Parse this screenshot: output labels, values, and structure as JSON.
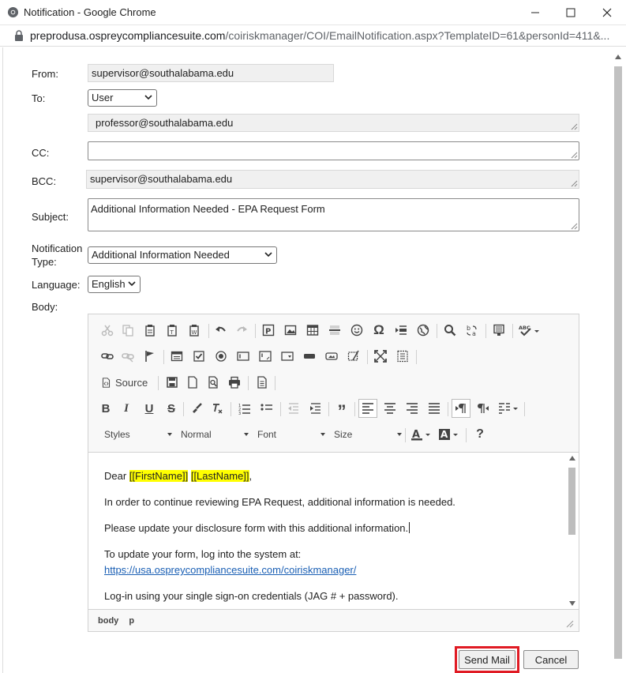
{
  "window": {
    "title": "Notification - Google Chrome",
    "url_host": "preprodusa.ospreycompliancesuite.com",
    "url_path": "/coiriskmanager/COI/EmailNotification.aspx?TemplateID=61&personId=411&..."
  },
  "form": {
    "from_label": "From:",
    "from_value": "supervisor@southalabama.edu",
    "to_label": "To:",
    "to_type": "User",
    "to_value": "professor@southalabama.edu",
    "cc_label": "CC:",
    "cc_value": "",
    "bcc_label": "BCC:",
    "bcc_value": "supervisor@southalabama.edu",
    "subject_label": "Subject:",
    "subject_value": "Additional Information Needed - EPA Request Form",
    "notif_label_1": "Notification",
    "notif_label_2": "Type:",
    "notif_value": "Additional Information Needed",
    "language_label": "Language:",
    "language_value": "English",
    "body_label": "Body:"
  },
  "toolbar": {
    "source_label": "Source",
    "styles_label": "Styles",
    "format_label": "Normal",
    "font_label": "Font",
    "size_label": "Size",
    "bold": "B",
    "italic": "I",
    "underline": "U",
    "strike": "S",
    "help": "?"
  },
  "body_content": {
    "greeting_prefix": "Dear ",
    "token_first": "[[FirstName]]",
    "token_last": "[[LastName]]",
    "greeting_suffix": ",",
    "line_1": "In order to continue reviewing EPA Request, additional information is needed.",
    "line_2": "Please update your disclosure form with this additional information.",
    "line_3": "To update your form, log into the system at:",
    "link": "https://usa.ospreycompliancesuite.com/coiriskmanager/",
    "line_4": "Log-in using your single sign-on credentials (JAG # + password)."
  },
  "status_path": [
    "body",
    "p"
  ],
  "buttons": {
    "send": "Send Mail",
    "cancel": "Cancel"
  },
  "colors": {
    "highlight": "#ffff00",
    "link": "#1a5fb4",
    "send_outline": "#e01b24"
  }
}
